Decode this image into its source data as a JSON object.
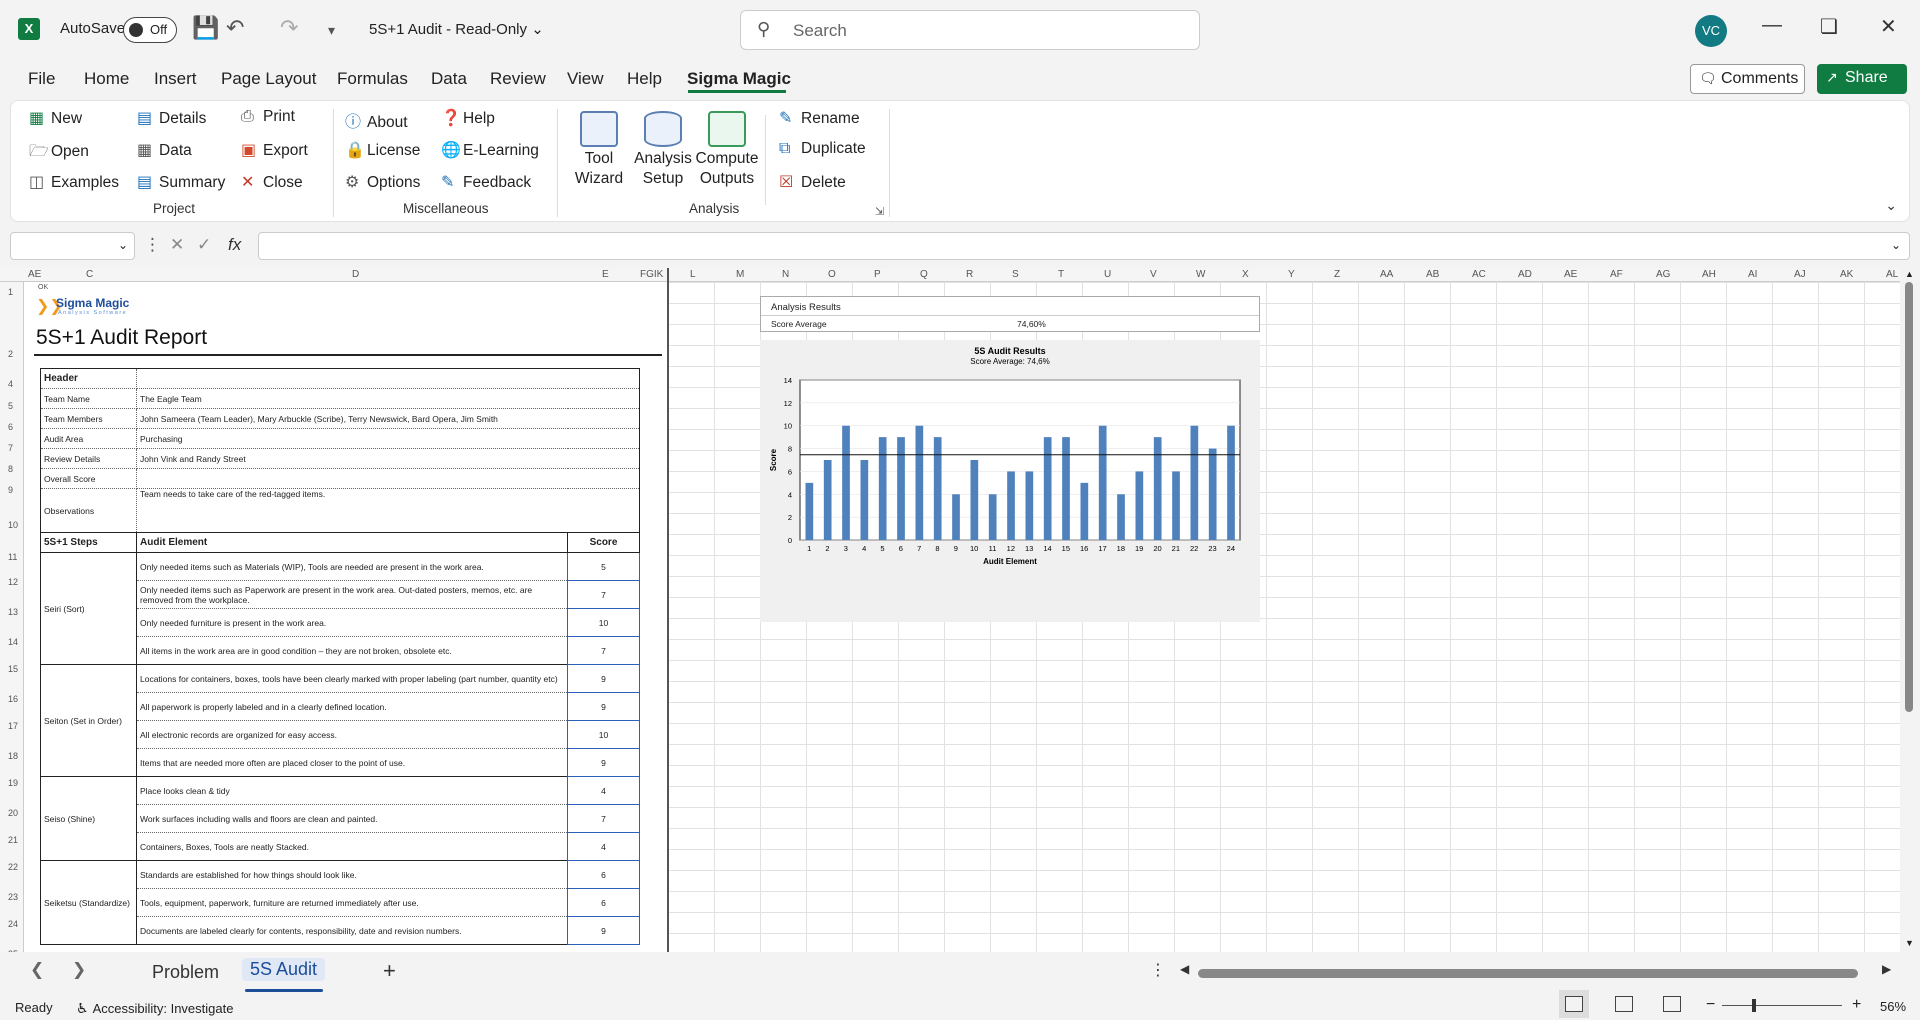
{
  "titlebar": {
    "autosave_label": "AutoSave",
    "autosave_state": "Off",
    "doc_title": "5S+1 Audit  -  Read-Only",
    "search_placeholder": "Search",
    "user_initials": "VC"
  },
  "menu": {
    "tabs": [
      "File",
      "Home",
      "Insert",
      "Page Layout",
      "Formulas",
      "Data",
      "Review",
      "View",
      "Help",
      "Sigma Magic"
    ],
    "active": "Sigma Magic",
    "comments_label": "Comments",
    "share_label": "Share"
  },
  "ribbon": {
    "project": {
      "label": "Project",
      "items": [
        "New",
        "Open",
        "Examples",
        "Details",
        "Data",
        "Summary",
        "Print",
        "Export",
        "Close"
      ]
    },
    "misc": {
      "label": "Miscellaneous",
      "items": [
        "About",
        "License",
        "Options",
        "Help",
        "E-Learning",
        "Feedback"
      ]
    },
    "analysis": {
      "label": "Analysis",
      "big": [
        "Tool Wizard",
        "Analysis Setup",
        "Compute Outputs"
      ],
      "items": [
        "Rename",
        "Duplicate",
        "Delete"
      ]
    }
  },
  "formula": {
    "fx": "fx"
  },
  "columns": [
    "AE",
    "C",
    "D",
    "E",
    "FGIK",
    "L",
    "M",
    "N",
    "O",
    "P",
    "Q",
    "R",
    "S",
    "T",
    "U",
    "V",
    "W",
    "X",
    "Y",
    "Z",
    "AA",
    "AB",
    "AC",
    "AD",
    "AE",
    "AF",
    "AG",
    "AH",
    "AI",
    "AJ",
    "AK",
    "AL"
  ],
  "rows": [
    "1",
    "2",
    "4",
    "5",
    "6",
    "7",
    "8",
    "9",
    "10",
    "11",
    "12",
    "13",
    "14",
    "15",
    "16",
    "17",
    "18",
    "19",
    "20",
    "21",
    "22",
    "23",
    "24",
    "25"
  ],
  "report": {
    "ok": "OK",
    "logo_name": "Sigma Magic",
    "logo_sub": "Analysis Software",
    "title": "5S+1 Audit Report",
    "header": [
      {
        "label": "Header",
        "value": ""
      },
      {
        "label": "Team Name",
        "value": "The Eagle Team"
      },
      {
        "label": "Team Members",
        "value": "John Sameera (Team Leader), Mary Arbuckle (Scribe), Terry Newswick, Bard Opera, Jim Smith"
      },
      {
        "label": "Audit Area",
        "value": "Purchasing"
      },
      {
        "label": "Review Details",
        "value": "John Vink and Randy Street"
      },
      {
        "label": "Overall Score",
        "value": ""
      },
      {
        "label": "Observations",
        "value": "Team needs to take care of the red-tagged items."
      }
    ],
    "cols": {
      "step": "5S+1 Steps",
      "element": "Audit Element",
      "score": "Score"
    },
    "steps": [
      {
        "name": "Seiri (Sort)",
        "items": [
          {
            "el": "Only needed items such as Materials (WIP), Tools are needed are present in the work area.",
            "score": "5"
          },
          {
            "el": "Only needed items such as Paperwork are present in the work area. Out-dated posters, memos, etc. are removed from the workplace.",
            "score": "7"
          },
          {
            "el": "Only needed furniture is present in the work area.",
            "score": "10"
          },
          {
            "el": "All items in the work area are in good condition – they are not broken, obsolete etc.",
            "score": "7"
          }
        ]
      },
      {
        "name": "Seiton (Set in Order)",
        "items": [
          {
            "el": "Locations for containers, boxes, tools have been clearly marked with proper labeling (part number, quantity etc)",
            "score": "9"
          },
          {
            "el": "All paperwork is properly labeled and in a clearly defined location.",
            "score": "9"
          },
          {
            "el": "All electronic records are organized for easy access.",
            "score": "10"
          },
          {
            "el": "Items that are needed more often are placed closer to the point of use.",
            "score": "9"
          }
        ]
      },
      {
        "name": "Seiso (Shine)",
        "items": [
          {
            "el": "Place looks clean & tidy",
            "score": "4"
          },
          {
            "el": "Work surfaces including walls and floors are clean and painted.",
            "score": "7"
          },
          {
            "el": "Containers, Boxes, Tools are neatly Stacked.",
            "score": "4"
          }
        ]
      },
      {
        "name": "Seiketsu (Standardize)",
        "items": [
          {
            "el": "Standards are established for how things should look like.",
            "score": "6"
          },
          {
            "el": "Tools, equipment, paperwork, furniture are returned immediately after use.",
            "score": "6"
          },
          {
            "el": "Documents are labeled clearly for contents, responsibility, date and revision numbers.",
            "score": "9"
          }
        ]
      }
    ]
  },
  "results": {
    "title": "Analysis Results",
    "label": "Score Average",
    "value": "74,60%"
  },
  "chart_data": {
    "type": "bar",
    "title": "5S Audit Results",
    "subtitle": "Score Average: 74,6%",
    "xlabel": "Audit Element",
    "ylabel": "Score",
    "ylim": [
      0,
      14
    ],
    "yticks": [
      0,
      2,
      4,
      6,
      8,
      10,
      12,
      14
    ],
    "categories": [
      "1",
      "2",
      "3",
      "4",
      "5",
      "6",
      "7",
      "8",
      "9",
      "10",
      "11",
      "12",
      "13",
      "14",
      "15",
      "16",
      "17",
      "18",
      "19",
      "20",
      "21",
      "22",
      "23",
      "24"
    ],
    "values": [
      5,
      7,
      10,
      7,
      9,
      9,
      10,
      9,
      4,
      7,
      4,
      6,
      6,
      9,
      9,
      5,
      10,
      4,
      6,
      9,
      6,
      10,
      8,
      10
    ],
    "reference_line": 7.46,
    "bar_color": "#4f81bd"
  },
  "sheets": {
    "tabs": [
      "Problem",
      "5S Audit"
    ],
    "active": "5S Audit"
  },
  "status": {
    "ready": "Ready",
    "accessibility": "Accessibility: Investigate",
    "zoom": "56%"
  }
}
